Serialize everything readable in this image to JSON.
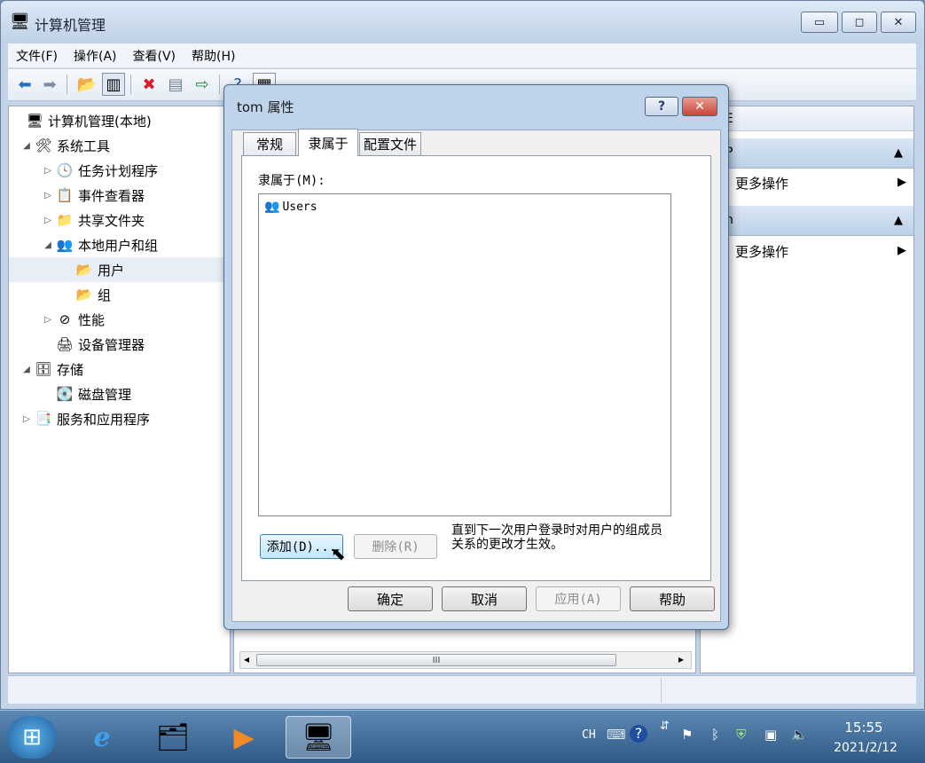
{
  "window": {
    "title": "计算机管理",
    "controls": {
      "minimize": "▭",
      "maximize": "◻",
      "close": "✕"
    }
  },
  "menubar": [
    "文件(F)",
    "操作(A)",
    "查看(V)",
    "帮助(H)"
  ],
  "tree": [
    {
      "label": "计算机管理(本地)",
      "icon": "computer-management-icon",
      "glyph": "🖥",
      "level": 0,
      "expander": ""
    },
    {
      "label": "系统工具",
      "icon": "system-tools-icon",
      "glyph": "🛠",
      "level": 1,
      "expander": "◢"
    },
    {
      "label": "任务计划程序",
      "icon": "task-scheduler-icon",
      "glyph": "🕓",
      "level": 2,
      "expander": "▷"
    },
    {
      "label": "事件查看器",
      "icon": "event-viewer-icon",
      "glyph": "📋",
      "level": 2,
      "expander": "▷"
    },
    {
      "label": "共享文件夹",
      "icon": "shared-folders-icon",
      "glyph": "📁",
      "level": 2,
      "expander": "▷"
    },
    {
      "label": "本地用户和组",
      "icon": "local-users-groups-icon",
      "glyph": "👥",
      "level": 2,
      "expander": "◢"
    },
    {
      "label": "用户",
      "icon": "folder-icon",
      "glyph": "📂",
      "level": 3,
      "expander": "",
      "selected": true
    },
    {
      "label": "组",
      "icon": "folder-icon",
      "glyph": "📂",
      "level": 3,
      "expander": ""
    },
    {
      "label": "性能",
      "icon": "performance-icon",
      "glyph": "⊘",
      "level": 2,
      "expander": "▷"
    },
    {
      "label": "设备管理器",
      "icon": "device-manager-icon",
      "glyph": "🖨",
      "level": 2,
      "expander": ""
    },
    {
      "label": "存储",
      "icon": "storage-icon",
      "glyph": "🗄",
      "level": 1,
      "expander": "◢"
    },
    {
      "label": "磁盘管理",
      "icon": "disk-management-icon",
      "glyph": "💽",
      "level": 2,
      "expander": ""
    },
    {
      "label": "服务和应用程序",
      "icon": "services-apps-icon",
      "glyph": "📑",
      "level": 1,
      "expander": "▷"
    }
  ],
  "actions": {
    "header_fragment": "E",
    "section1_fragment": "P",
    "section2_fragment": "n",
    "more_actions": "更多操作",
    "collapse_glyph": "▲",
    "submenu_glyph": "▶"
  },
  "scrollbar": {
    "grip": "III",
    "left": "◂",
    "right": "▸"
  },
  "dialog": {
    "title": "tom 属性",
    "help_button": "?",
    "close_button": "✕",
    "tabs": [
      "常规",
      "隶属于",
      "配置文件"
    ],
    "active_tab": 1,
    "member_of_label": "隶属于(M):",
    "members": [
      {
        "name": "Users",
        "icon": "users-group-icon"
      }
    ],
    "add_button": "添加(D)...",
    "remove_button": "删除(R)",
    "note": "直到下一次用户登录时对用户的组成员关系的更改才生效。",
    "ok_button": "确定",
    "cancel_button": "取消",
    "apply_button": "应用(A)",
    "help_text_button": "帮助"
  },
  "taskbar": {
    "tray_lang": "CH",
    "time": "15:55",
    "date": "2021/2/12",
    "apps": [
      {
        "name": "start-button",
        "glyph": "⊞"
      },
      {
        "name": "internet-explorer-icon",
        "glyph": "e"
      },
      {
        "name": "file-explorer-icon",
        "glyph": "🗂"
      },
      {
        "name": "media-player-icon",
        "glyph": "▶"
      },
      {
        "name": "computer-management-taskbar-icon",
        "glyph": "🖥"
      }
    ]
  },
  "colors": {
    "accent": "#3c7fb1",
    "close_red": "#c9463d",
    "taskbar": "#2f5a86"
  }
}
